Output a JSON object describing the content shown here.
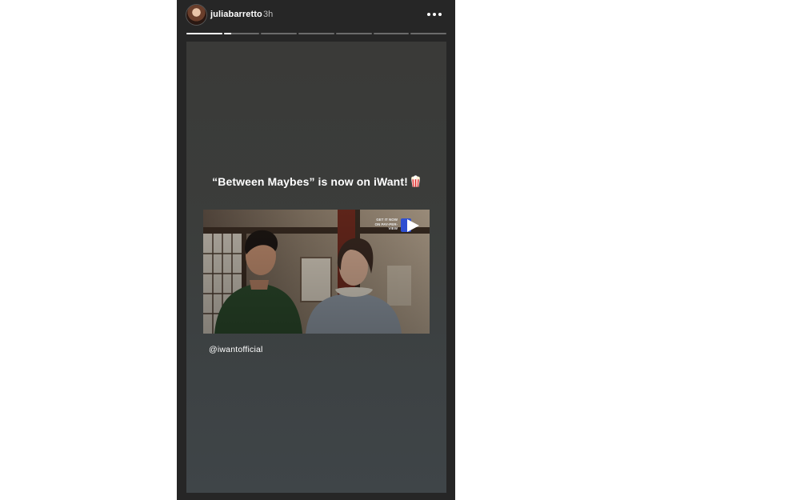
{
  "story": {
    "username": "juliabarretto",
    "timestamp": "3h",
    "headline": "“Between Maybes” is now on iWant!",
    "media_badge": [
      "GET IT NOW",
      "ON PAY-PER-VIEW"
    ],
    "mention": "@iwantofficial",
    "progress": [
      1,
      0.2,
      0,
      0,
      0,
      0,
      0
    ],
    "icons": {
      "avatar": "profile-avatar",
      "more": "more-options-icon",
      "emoji": "popcorn-emoji",
      "play": "play-logo-icon"
    },
    "colors": {
      "viewer_bg": "#262626",
      "story_bg": "#3b3e3d",
      "progress_active": "#ffffff",
      "progress_inactive": "#6b6b6b",
      "badge_accent": "#2f4fd1"
    }
  }
}
